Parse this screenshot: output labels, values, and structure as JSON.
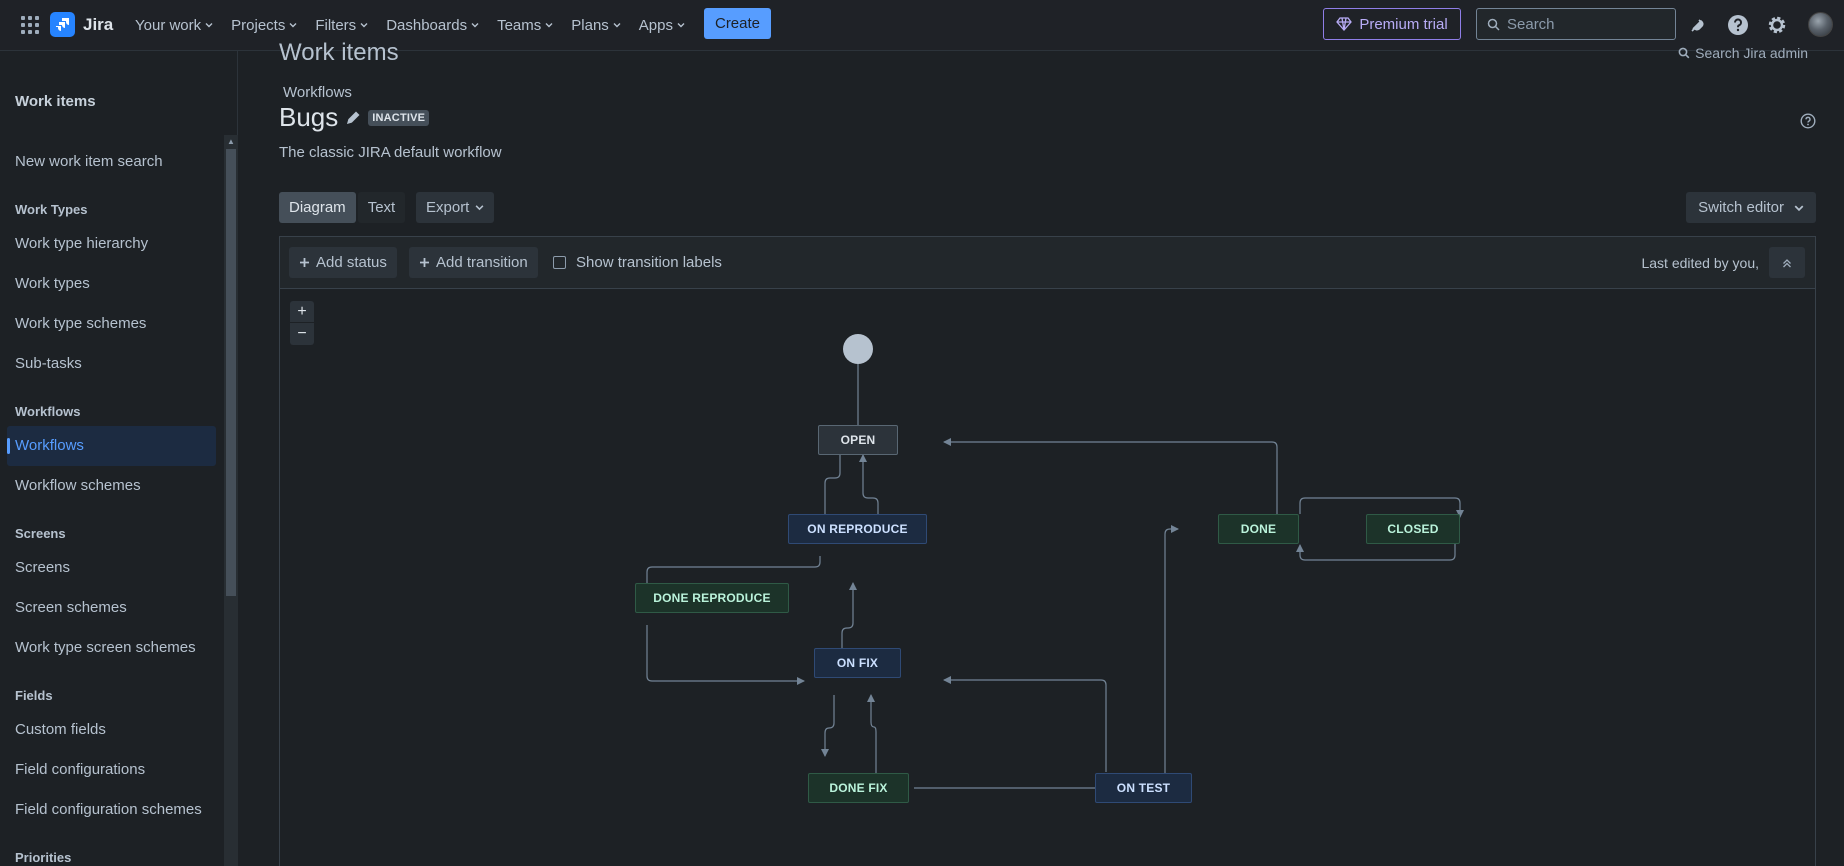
{
  "topnav": {
    "product": "Jira",
    "items": [
      {
        "label": "Your work"
      },
      {
        "label": "Projects"
      },
      {
        "label": "Filters"
      },
      {
        "label": "Dashboards"
      },
      {
        "label": "Teams"
      },
      {
        "label": "Plans"
      },
      {
        "label": "Apps"
      }
    ],
    "create_label": "Create",
    "premium_label": "Premium trial",
    "search_placeholder": "Search",
    "icons": [
      "notifications-icon",
      "help-icon",
      "settings-icon"
    ]
  },
  "sidebar": {
    "title": "Work items",
    "items": [
      {
        "kind": "item",
        "label": "New work item search"
      },
      {
        "kind": "head",
        "label": "Work Types"
      },
      {
        "kind": "item",
        "label": "Work type hierarchy"
      },
      {
        "kind": "item",
        "label": "Work types"
      },
      {
        "kind": "item",
        "label": "Work type schemes"
      },
      {
        "kind": "item",
        "label": "Sub-tasks"
      },
      {
        "kind": "head",
        "label": "Workflows"
      },
      {
        "kind": "item",
        "label": "Workflows",
        "active": true
      },
      {
        "kind": "item",
        "label": "Workflow schemes"
      },
      {
        "kind": "head",
        "label": "Screens"
      },
      {
        "kind": "item",
        "label": "Screens"
      },
      {
        "kind": "item",
        "label": "Screen schemes"
      },
      {
        "kind": "item",
        "label": "Work type screen schemes"
      },
      {
        "kind": "head",
        "label": "Fields"
      },
      {
        "kind": "item",
        "label": "Custom fields"
      },
      {
        "kind": "item",
        "label": "Field configurations"
      },
      {
        "kind": "item",
        "label": "Field configuration schemes"
      },
      {
        "kind": "head",
        "label": "Priorities"
      }
    ]
  },
  "page": {
    "section_title": "Work items",
    "admin_search": "Search Jira admin",
    "breadcrumb": "Workflows",
    "title": "Bugs",
    "status_lozenge": "INACTIVE",
    "description": "The classic JIRA default workflow",
    "view_diagram": "Diagram",
    "view_text": "Text",
    "export_label": "Export",
    "switch_editor_label": "Switch editor"
  },
  "toolbar": {
    "add_status": "Add status",
    "add_transition": "Add transition",
    "show_labels": "Show transition labels",
    "show_labels_checked": false,
    "last_edited": "Last edited by you,"
  },
  "zoom": {
    "in": "+",
    "out": "−"
  },
  "workflow": {
    "statuses": [
      {
        "id": "open",
        "label": "OPEN",
        "category": "todo"
      },
      {
        "id": "on_reproduce",
        "label": "ON REPRODUCE",
        "category": "prog"
      },
      {
        "id": "done_reproduce",
        "label": "DONE REPRODUCE",
        "category": "done"
      },
      {
        "id": "on_fix",
        "label": "ON FIX",
        "category": "prog"
      },
      {
        "id": "done_fix",
        "label": "DONE FIX",
        "category": "done"
      },
      {
        "id": "on_test",
        "label": "ON TEST",
        "category": "prog"
      },
      {
        "id": "done",
        "label": "DONE",
        "category": "done"
      },
      {
        "id": "closed",
        "label": "CLOSED",
        "category": "done"
      }
    ],
    "transitions": [
      [
        "start",
        "open"
      ],
      [
        "open",
        "on_reproduce"
      ],
      [
        "on_reproduce",
        "open"
      ],
      [
        "on_reproduce",
        "done_reproduce"
      ],
      [
        "done_reproduce",
        "on_fix"
      ],
      [
        "on_fix",
        "on_reproduce"
      ],
      [
        "on_fix",
        "done_fix"
      ],
      [
        "done_fix",
        "on_fix"
      ],
      [
        "done_fix",
        "on_test"
      ],
      [
        "on_test",
        "on_fix"
      ],
      [
        "on_test",
        "done"
      ],
      [
        "done",
        "open"
      ],
      [
        "done",
        "closed"
      ],
      [
        "closed",
        "done"
      ]
    ]
  },
  "colors": {
    "accent": "#579dff",
    "premium": "#8f7ee7",
    "edge": "#738496"
  }
}
